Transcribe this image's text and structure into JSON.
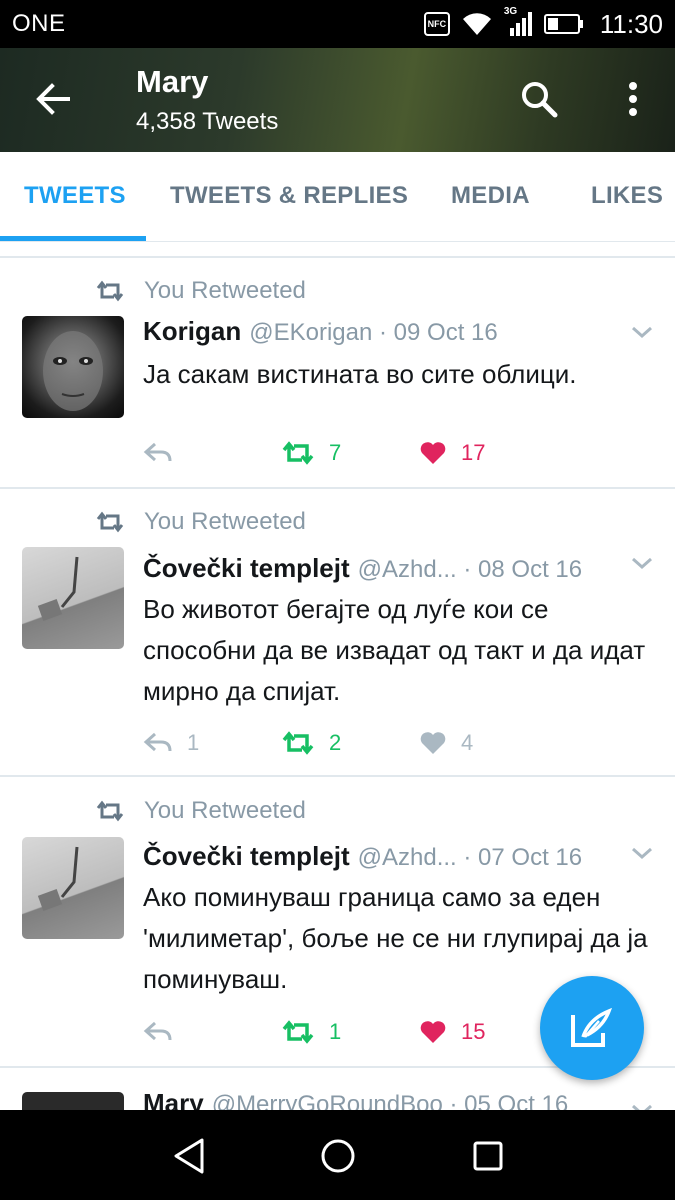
{
  "status_bar": {
    "carrier": "ONE",
    "nfc": "NFC",
    "network": "3G",
    "time": "11:30"
  },
  "header": {
    "name": "Mary",
    "tweet_count": "4,358 Tweets"
  },
  "tabs": [
    {
      "label": "TWEETS",
      "active": true
    },
    {
      "label": "TWEETS & REPLIES",
      "active": false
    },
    {
      "label": "MEDIA",
      "active": false
    },
    {
      "label": "LIKES",
      "active": false
    }
  ],
  "tweets": [
    {
      "retweet_label": "You Retweeted",
      "name": "Korigan",
      "handle": "@EKorigan",
      "date": "· 09 Oct 16",
      "text": "Ја сакам вистината во сите облици.",
      "replies": "",
      "retweets": "7",
      "likes": "17",
      "liked": true
    },
    {
      "retweet_label": "You Retweeted",
      "name": "Čovečki templejt",
      "handle": "@Azhd...",
      "date": "· 08 Oct 16",
      "text": "Во животот бегајте од луѓе кои се способни да ве извадат од такт и да идат мирно да спијат.",
      "replies": "1",
      "retweets": "2",
      "likes": "4",
      "liked": false
    },
    {
      "retweet_label": "You Retweeted",
      "name": "Čovečki templejt",
      "handle": "@Azhd...",
      "date": "· 07 Oct 16",
      "text": "Ако поминуваш граница само за еден 'милиметар', боље не се ни глупирај да ја поминуваш.",
      "replies": "",
      "retweets": "1",
      "likes": "15",
      "liked": true
    },
    {
      "name": "Mary",
      "handle": "@MerryGoRoundBoo",
      "date": "· 05 Oct 16"
    }
  ],
  "colors": {
    "accent": "#1da1f2",
    "retweet": "#17bf63",
    "like": "#e0245e",
    "muted": "#8899a6"
  },
  "icons": {
    "back": "arrow-left-icon",
    "search": "search-icon",
    "more": "more-vert-icon",
    "compose": "compose-icon"
  }
}
